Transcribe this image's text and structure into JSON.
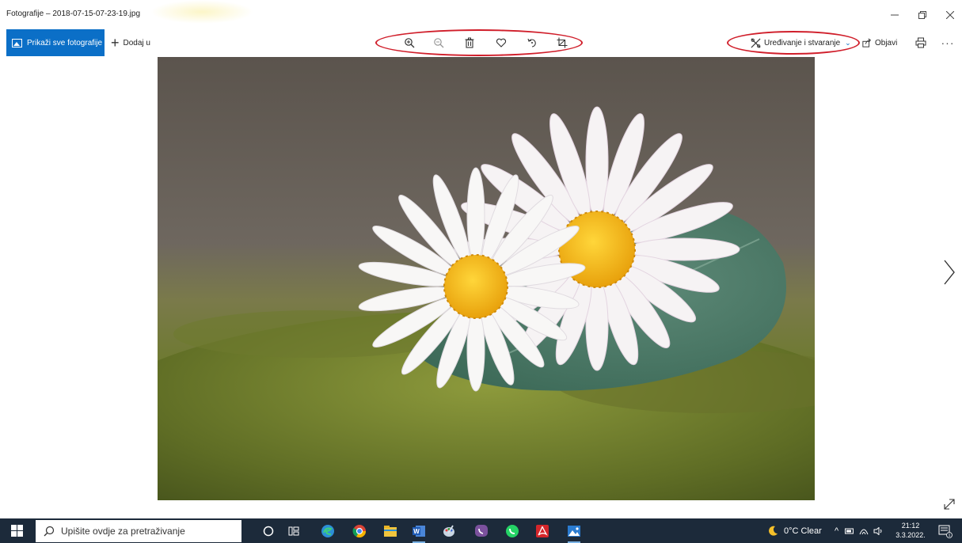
{
  "window": {
    "title": "Fotografije – 2018-07-15-07-23-19.jpg",
    "controls": {
      "minimize": "—",
      "maximize": "❐",
      "close": "✕"
    }
  },
  "toolbar": {
    "see_all_label": "Prikaži sve fotografije",
    "add_to_label": "Dodaj u",
    "edit_create_label": "Uređivanje i stvaranje",
    "share_label": "Objavi",
    "more_label": "···",
    "tools": [
      "zoom-in-icon",
      "zoom-out-icon",
      "delete-icon",
      "favorite-icon",
      "rotate-icon",
      "crop-icon"
    ]
  },
  "viewer": {
    "next_label": "›",
    "image_subject": "daisies"
  },
  "taskbar": {
    "search_placeholder": "Upišite ovdje za pretraživanje",
    "apps": [
      "cortana-icon",
      "task-view-icon",
      "edge-icon",
      "chrome-icon",
      "file-explorer-icon",
      "word-icon",
      "photo-app-icon",
      "viber-icon",
      "whatsapp-icon",
      "acrobat-icon",
      "photos-icon"
    ],
    "weather": "0°C Clear",
    "time": "21:12",
    "date": "3.3.2022.",
    "notification_count": "1"
  },
  "colors": {
    "accent": "#0b6fc7",
    "highlight_ellipse": "#d01e2a",
    "taskbar_bg": "#1c2a3a"
  }
}
